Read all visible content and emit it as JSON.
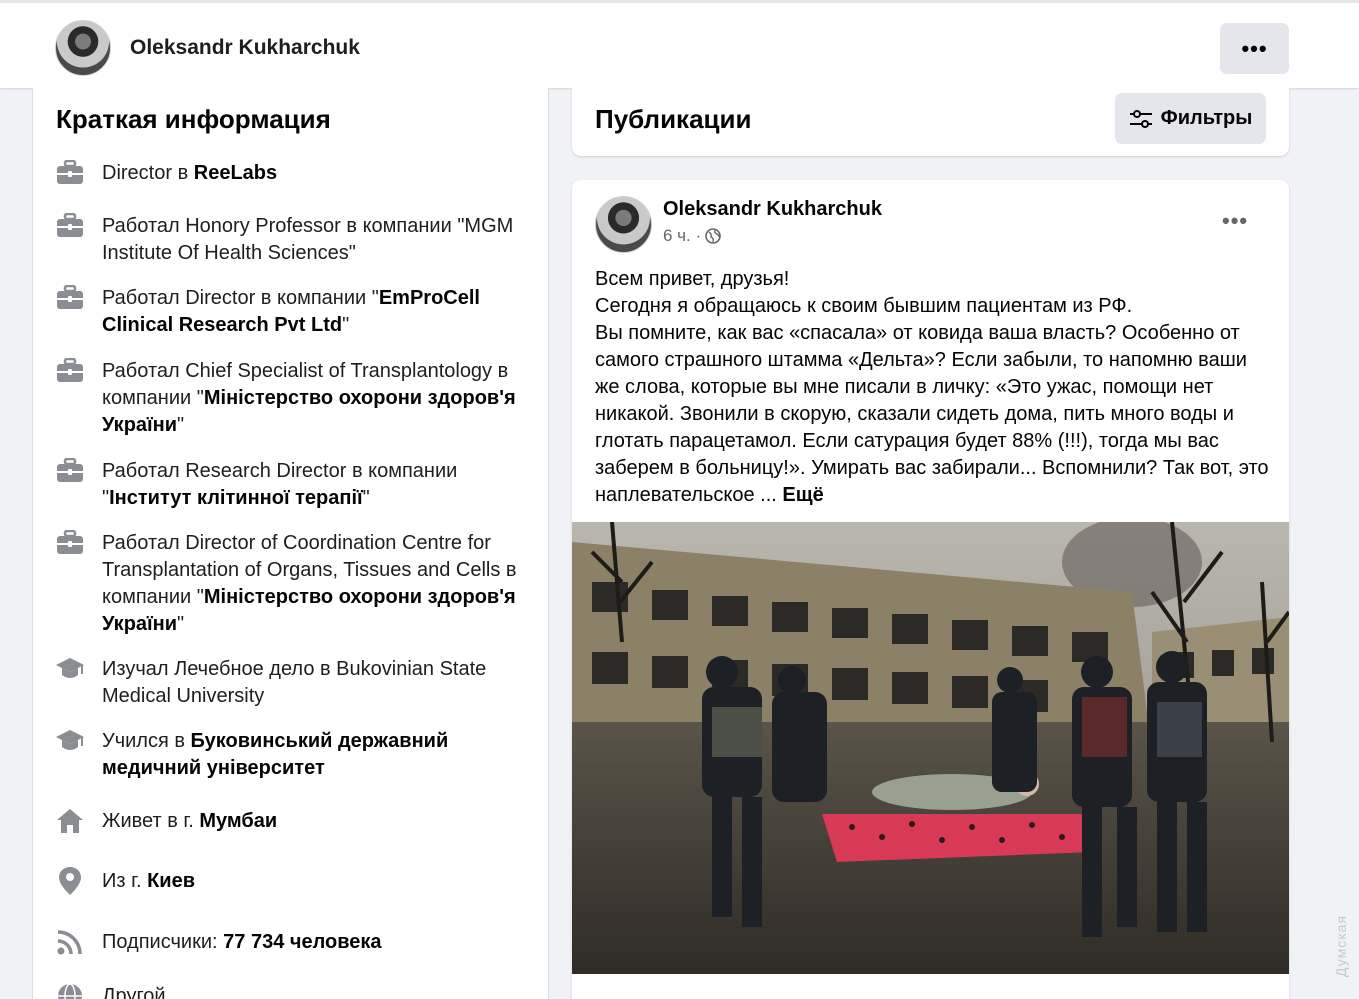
{
  "header": {
    "name": "Oleksandr Kukharchuk",
    "more_label": "•••"
  },
  "intro": {
    "title": "Краткая информация",
    "items": [
      {
        "icon": "briefcase-icon",
        "prefix": "Director в ",
        "bold": "ReeLabs",
        "suffix": ""
      },
      {
        "icon": "briefcase-icon",
        "prefix": "Работал Honory Professor в компании \"MGM Institute Of Health Sciences\"",
        "bold": "",
        "suffix": ""
      },
      {
        "icon": "briefcase-icon",
        "prefix": "Работал Director в компании \"",
        "bold": "EmProCell Clinical Research Pvt Ltd",
        "suffix": "\""
      },
      {
        "icon": "briefcase-icon",
        "prefix": "Работал Chief Specialist of Transplantology в компании \"",
        "bold": "Міністерство охорони здоров'я України",
        "suffix": "\""
      },
      {
        "icon": "briefcase-icon",
        "prefix": "Работал Research Director в компании \"",
        "bold": "Інститут клітинної терапії",
        "suffix": "\""
      },
      {
        "icon": "briefcase-icon",
        "prefix": "Работал Director of Coordination Centre for Transplantation of Organs, Tissues and Cells в компании \"",
        "bold": "Міністерство охорони здоров'я України",
        "suffix": "\""
      },
      {
        "icon": "graduation-cap-icon",
        "prefix": "Изучал Лечебное дело в Bukovinian State Medical University",
        "bold": "",
        "suffix": ""
      },
      {
        "icon": "graduation-cap-icon",
        "prefix": "Учился в ",
        "bold": "Буковинський державний медичний університет",
        "suffix": ""
      },
      {
        "icon": "home-icon",
        "prefix": "Живет в г. ",
        "bold": "Мумбаи",
        "suffix": ""
      },
      {
        "icon": "location-pin-icon",
        "prefix": "Из г. ",
        "bold": "Киев",
        "suffix": ""
      },
      {
        "icon": "rss-followers-icon",
        "prefix": "Подписчики: ",
        "bold": "77 734 человека",
        "suffix": ""
      },
      {
        "icon": "globe-icon",
        "prefix": "Другой",
        "bold": "",
        "suffix": ""
      }
    ]
  },
  "publications": {
    "title": "Публикации",
    "filter_label": "Фильтры"
  },
  "post": {
    "author": "Oleksandr Kukharchuk",
    "time": "6 ч. ·",
    "lines": [
      "Всем привет, друзья!",
      "Сегодня я обращаюсь к своим бывшим пациентам из РФ.",
      "Вы помните, как вас «спасала» от ковида ваша власть? Особенно от самого страшного штамма «Дельта»? Если забыли, то напомню ваши же слова, которые вы мне писали в личку: «Это ужас, помощи нет никакой. Звонили в скорую, сказали сидеть дома, пить много воды и глотать парацетамол. Если сатурация будет 88% (!!!), тогда мы вас заберем в больницу!». Умирать вас забирали... Вспомнили? Так вот, это наплевательское ..."
    ],
    "see_more": "Ещё"
  },
  "watermark": "Думская",
  "colors": {
    "background": "#f0f2f5",
    "card": "#ffffff",
    "button": "#e4e6eb",
    "secondary_text": "#65676b",
    "icon": "#65676b"
  }
}
